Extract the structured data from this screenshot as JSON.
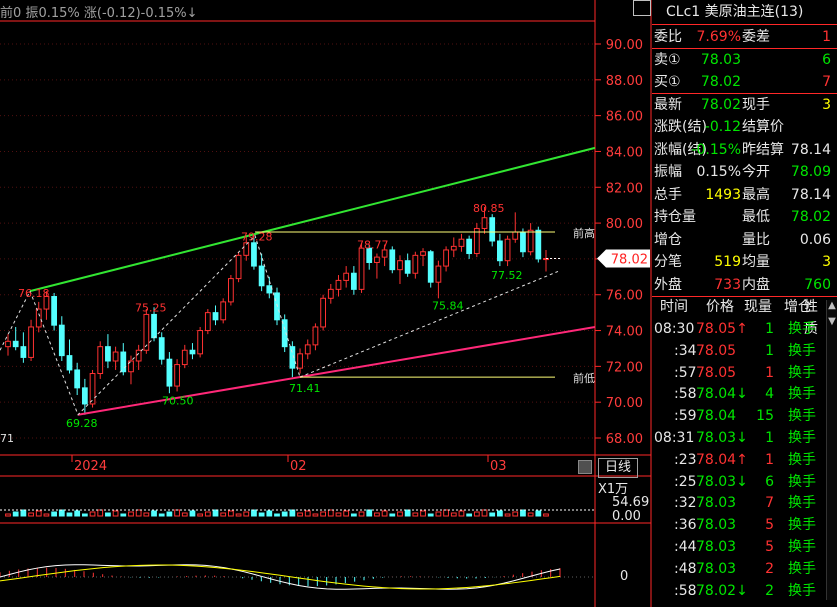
{
  "header": {
    "text_a": "前0",
    "label_amp": "振",
    "amp": "0.15%",
    "label_chg": "涨(-0.12)",
    "chg_pct": "-0.15%↓"
  },
  "price_axis": [
    "90.00",
    "88.00",
    "86.00",
    "84.00",
    "82.00",
    "80.00",
    "78.00",
    "76.00",
    "74.00",
    "72.00",
    "70.00",
    "68.00"
  ],
  "last_price_tag": "78.02",
  "annotations": {
    "a1": "76.18",
    "a2": "75.25",
    "a3": "69.28",
    "a4": "70.50",
    "a5": "79.28",
    "a6": "71.41",
    "a7": "78.77",
    "a8": "75.84",
    "a9": "80.85",
    "a10": "77.52",
    "left_partial": "71",
    "prev_high": "前高",
    "prev_low": "前低"
  },
  "time_axis": [
    "2024",
    "02",
    "03"
  ],
  "period_button": "日线",
  "volume": {
    "scale_label": "X1万",
    "max": "54.69",
    "zero": "0.00"
  },
  "macd": {
    "zero": "0"
  },
  "quote": {
    "title": "CLc1 美原油主连(13)",
    "rows": [
      {
        "l1": "委比",
        "v1": "7.69%",
        "v1c": "red",
        "l2": "委差",
        "v2": "1",
        "v2c": "red"
      },
      {
        "l1": "卖①",
        "v1": "78.03",
        "v1c": "grn",
        "l2": "",
        "v2": "6",
        "v2c": "grn"
      },
      {
        "l1": "买①",
        "v1": "78.02",
        "v1c": "grn",
        "l2": "",
        "v2": "7",
        "v2c": "red"
      },
      {
        "l1": "最新",
        "v1": "78.02",
        "v1c": "grn",
        "l2": "现手",
        "v2": "3",
        "v2c": "yel"
      },
      {
        "l1": "涨跌(结)",
        "v1": "-0.12",
        "v1c": "grn",
        "l2": "结算价",
        "v2": "",
        "v2c": "wht"
      },
      {
        "l1": "涨幅(结)",
        "v1": "-0.15%",
        "v1c": "grn",
        "l2": "昨结算",
        "v2": "78.14",
        "v2c": "wht"
      },
      {
        "l1": "振幅",
        "v1": "0.15%",
        "v1c": "wht",
        "l2": "今开",
        "v2": "78.09",
        "v2c": "grn"
      },
      {
        "l1": "总手",
        "v1": "1493",
        "v1c": "yel",
        "l2": "最高",
        "v2": "78.14",
        "v2c": "wht"
      },
      {
        "l1": "持仓量",
        "v1": "",
        "v1c": "yel",
        "l2": "最低",
        "v2": "78.02",
        "v2c": "grn"
      },
      {
        "l1": "增仓",
        "v1": "",
        "v1c": "yel",
        "l2": "量比",
        "v2": "0.06",
        "v2c": "wht"
      },
      {
        "l1": "分笔",
        "v1": "519",
        "v1c": "yel",
        "l2": "均量",
        "v2": "3",
        "v2c": "yel"
      },
      {
        "l1": "外盘",
        "v1": "733",
        "v1c": "red",
        "l2": "内盘",
        "v2": "760",
        "v2c": "grn"
      }
    ],
    "tick_headers": [
      "时间",
      "价格",
      "现量",
      "增仓",
      "性质"
    ],
    "ticks": [
      {
        "t": "08:30",
        "p": "78.05↑",
        "pc": "red",
        "q": "1",
        "qc": "grn",
        "n": "换手"
      },
      {
        "t": ":34",
        "p": "78.05",
        "pc": "red",
        "q": "1",
        "qc": "grn",
        "n": "换手"
      },
      {
        "t": ":57",
        "p": "78.05",
        "pc": "red",
        "q": "1",
        "qc": "red",
        "n": "换手"
      },
      {
        "t": ":58",
        "p": "78.04↓",
        "pc": "grn",
        "q": "4",
        "qc": "grn",
        "n": "换手"
      },
      {
        "t": ":59",
        "p": "78.04",
        "pc": "grn",
        "q": "15",
        "qc": "grn",
        "n": "换手"
      },
      {
        "t": "08:31",
        "p": "78.03↓",
        "pc": "grn",
        "q": "1",
        "qc": "grn",
        "n": "换手"
      },
      {
        "t": ":23",
        "p": "78.04↑",
        "pc": "red",
        "q": "1",
        "qc": "red",
        "n": "换手"
      },
      {
        "t": ":25",
        "p": "78.03↓",
        "pc": "grn",
        "q": "6",
        "qc": "grn",
        "n": "换手"
      },
      {
        "t": ":32",
        "p": "78.03",
        "pc": "grn",
        "q": "7",
        "qc": "red",
        "n": "换手"
      },
      {
        "t": ":36",
        "p": "78.03",
        "pc": "grn",
        "q": "5",
        "qc": "red",
        "n": "换手"
      },
      {
        "t": ":44",
        "p": "78.03",
        "pc": "grn",
        "q": "5",
        "qc": "red",
        "n": "换手"
      },
      {
        "t": ":48",
        "p": "78.03",
        "pc": "grn",
        "q": "2",
        "qc": "red",
        "n": "换手"
      },
      {
        "t": ":58",
        "p": "78.02↓",
        "pc": "grn",
        "q": "2",
        "qc": "grn",
        "n": "换手"
      }
    ]
  },
  "colors": {
    "up": "#ff3232",
    "down": "#54ffff",
    "channel_top": "#32e632",
    "channel_bottom": "#ff2878",
    "border": "#ff2828"
  },
  "chart_data": {
    "type": "candlestick",
    "symbol": "CLc1",
    "ylim": [
      67,
      92
    ],
    "candles": [
      [
        73.1,
        73.8,
        72.6,
        73.4
      ],
      [
        73.4,
        74.2,
        72.9,
        73.1
      ],
      [
        73.1,
        73.9,
        72.2,
        72.5
      ],
      [
        72.5,
        74.6,
        72.3,
        74.2
      ],
      [
        74.2,
        75.6,
        73.9,
        75.2
      ],
      [
        75.2,
        76.2,
        74.6,
        75.9
      ],
      [
        75.9,
        76.1,
        74.0,
        74.3
      ],
      [
        74.3,
        74.8,
        72.3,
        72.6
      ],
      [
        72.6,
        73.5,
        71.6,
        71.8
      ],
      [
        71.8,
        72.2,
        70.4,
        70.8
      ],
      [
        70.8,
        71.3,
        69.3,
        69.9
      ],
      [
        69.9,
        71.8,
        69.7,
        71.6
      ],
      [
        71.6,
        73.4,
        71.3,
        73.1
      ],
      [
        73.1,
        73.8,
        71.9,
        72.3
      ],
      [
        72.3,
        73.1,
        71.8,
        72.8
      ],
      [
        72.8,
        73.3,
        71.5,
        71.7
      ],
      [
        71.7,
        72.6,
        71.0,
        72.3
      ],
      [
        72.3,
        73.2,
        71.8,
        72.9
      ],
      [
        72.9,
        75.2,
        72.7,
        74.9
      ],
      [
        74.9,
        75.3,
        73.4,
        73.6
      ],
      [
        73.6,
        73.9,
        72.1,
        72.4
      ],
      [
        72.4,
        72.8,
        70.5,
        70.9
      ],
      [
        70.9,
        72.4,
        70.6,
        72.1
      ],
      [
        72.1,
        73.2,
        71.9,
        72.9
      ],
      [
        72.9,
        73.3,
        72.4,
        72.7
      ],
      [
        72.7,
        74.2,
        72.5,
        74.0
      ],
      [
        74.0,
        75.2,
        73.8,
        75.0
      ],
      [
        75.0,
        75.4,
        74.3,
        74.6
      ],
      [
        74.6,
        75.8,
        74.4,
        75.6
      ],
      [
        75.6,
        77.1,
        75.4,
        76.9
      ],
      [
        76.9,
        78.4,
        76.7,
        78.2
      ],
      [
        78.2,
        79.3,
        77.9,
        78.9
      ],
      [
        78.9,
        79.2,
        77.4,
        77.6
      ],
      [
        77.6,
        78.3,
        76.2,
        76.5
      ],
      [
        76.5,
        77.0,
        75.8,
        76.1
      ],
      [
        76.1,
        76.4,
        74.3,
        74.6
      ],
      [
        74.6,
        74.9,
        72.8,
        73.1
      ],
      [
        73.1,
        73.4,
        71.4,
        71.9
      ],
      [
        71.9,
        73.0,
        71.6,
        72.7
      ],
      [
        72.7,
        73.5,
        72.4,
        73.2
      ],
      [
        73.2,
        74.4,
        72.9,
        74.2
      ],
      [
        74.2,
        76.0,
        74.0,
        75.8
      ],
      [
        75.8,
        76.6,
        75.5,
        76.3
      ],
      [
        76.3,
        77.1,
        75.9,
        76.8
      ],
      [
        76.8,
        77.6,
        76.4,
        77.2
      ],
      [
        77.2,
        77.6,
        76.0,
        76.3
      ],
      [
        76.3,
        78.9,
        76.1,
        78.6
      ],
      [
        78.6,
        78.8,
        77.4,
        77.8
      ],
      [
        77.8,
        78.3,
        76.9,
        78.1
      ],
      [
        78.1,
        78.8,
        77.6,
        78.5
      ],
      [
        78.5,
        78.7,
        77.2,
        77.4
      ],
      [
        77.4,
        78.2,
        76.6,
        77.9
      ],
      [
        77.9,
        78.3,
        77.0,
        77.2
      ],
      [
        77.2,
        78.4,
        76.9,
        78.2
      ],
      [
        78.2,
        78.6,
        77.6,
        78.4
      ],
      [
        78.4,
        78.5,
        76.4,
        76.7
      ],
      [
        76.7,
        77.9,
        75.8,
        77.6
      ],
      [
        77.6,
        78.7,
        77.3,
        78.5
      ],
      [
        78.5,
        79.2,
        78.1,
        78.7
      ],
      [
        78.7,
        79.4,
        78.4,
        79.1
      ],
      [
        79.1,
        79.3,
        78.0,
        78.3
      ],
      [
        78.3,
        80.0,
        78.1,
        79.7
      ],
      [
        79.7,
        80.9,
        79.4,
        80.3
      ],
      [
        80.3,
        80.5,
        78.7,
        79.0
      ],
      [
        79.0,
        79.4,
        77.6,
        77.9
      ],
      [
        77.9,
        79.3,
        77.6,
        79.1
      ],
      [
        79.1,
        80.6,
        78.9,
        79.5
      ],
      [
        79.5,
        79.7,
        78.1,
        78.4
      ],
      [
        78.4,
        80.0,
        78.2,
        79.6
      ],
      [
        79.6,
        79.8,
        77.8,
        78.0
      ],
      [
        78.0,
        78.5,
        77.3,
        78.02
      ]
    ],
    "channel_top_ends": [
      76.2,
      84.2
    ],
    "channel_bottom_ends": [
      69.3,
      74.2
    ],
    "prev_high": 79.5,
    "prev_low": 71.4
  }
}
